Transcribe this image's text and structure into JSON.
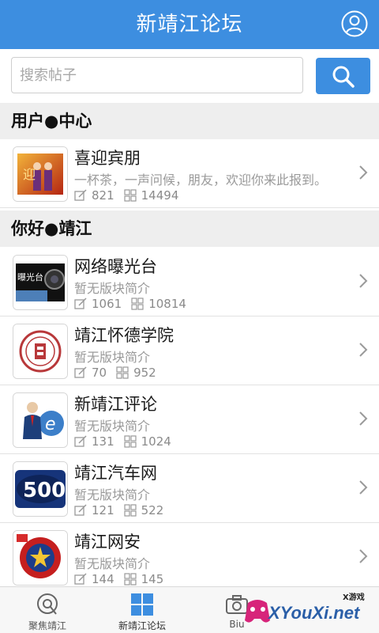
{
  "header": {
    "title": "新靖江论坛",
    "avatar_icon": "user-circle-icon"
  },
  "search": {
    "placeholder": "搜索帖子",
    "button_icon": "search-icon"
  },
  "sections": [
    {
      "title": "用户●中心",
      "items": [
        {
          "title": "喜迎宾朋",
          "desc": "一杯茶，一声问候，朋友，欢迎你来此报到。",
          "posts": "821",
          "threads": "14494",
          "icon": "welcome-banner-icon"
        }
      ]
    },
    {
      "title": "你好●靖江",
      "items": [
        {
          "title": "网络曝光台",
          "desc": "暂无版块简介",
          "posts": "1061",
          "threads": "10814",
          "icon": "camera-exposure-icon",
          "thumb_text": "曝光台"
        },
        {
          "title": "靖江怀德学院",
          "desc": "暂无版块简介",
          "posts": "70",
          "threads": "952",
          "icon": "college-seal-icon"
        },
        {
          "title": "新靖江评论",
          "desc": "暂无版块简介",
          "posts": "131",
          "threads": "1024",
          "icon": "commentator-icon"
        },
        {
          "title": "靖江汽车网",
          "desc": "暂无版块简介",
          "posts": "121",
          "threads": "522",
          "icon": "car-500-icon",
          "thumb_text": "500"
        },
        {
          "title": "靖江网安",
          "desc": "暂无版块简介",
          "posts": "144",
          "threads": "145",
          "icon": "police-emblem-icon"
        }
      ]
    }
  ],
  "bottom_nav": [
    {
      "label": "聚焦靖江",
      "icon": "focus-icon",
      "active": false
    },
    {
      "label": "新靖江论坛",
      "icon": "grid-icon",
      "active": true
    },
    {
      "label": "Biu",
      "icon": "camera-icon",
      "active": false
    }
  ],
  "watermark": {
    "text": "XYouXi.net",
    "small": "X游戏"
  },
  "colors": {
    "primary": "#3d8ee0",
    "section_bg": "#eeeeee",
    "muted": "#9a9a9a"
  }
}
